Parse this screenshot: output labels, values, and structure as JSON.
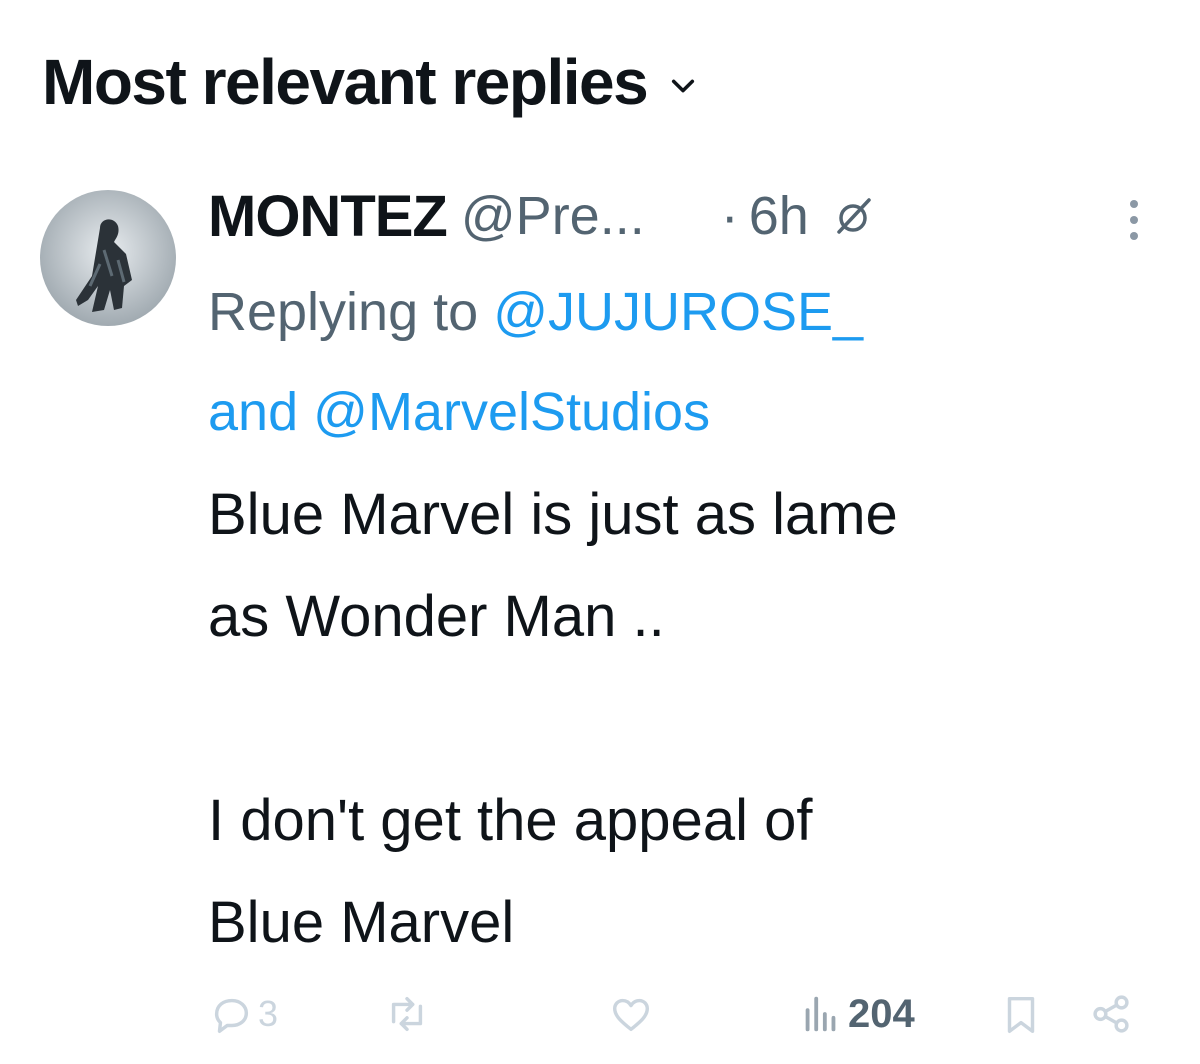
{
  "header": {
    "title": "Most relevant replies"
  },
  "reply": {
    "display_name": "MONTEZ",
    "handle": "@Pre...",
    "separator": "·",
    "time": "6h",
    "replying_lead": "Replying to",
    "mention_1": "@JUJUROSE_",
    "and_text": "and",
    "mention_2": "@MarvelStudios",
    "text_line_1": "Blue Marvel is just as lame",
    "text_line_2": "as Wonder Man ..",
    "text_line_3": "I don't get the appeal of",
    "text_line_4": "Blue Marvel"
  },
  "actions": {
    "replies": "3",
    "reposts": "",
    "likes": "",
    "views": "204"
  },
  "colors": {
    "text": "#0f1419",
    "secondary": "#536471",
    "accent": "#1d9bf0",
    "action_icons": "#cbd5de"
  },
  "icons": [
    "chevron-down-icon",
    "grok-icon",
    "more-vertical-icon",
    "reply-icon",
    "repost-icon",
    "like-icon",
    "views-icon",
    "bookmark-icon",
    "share-icon"
  ]
}
